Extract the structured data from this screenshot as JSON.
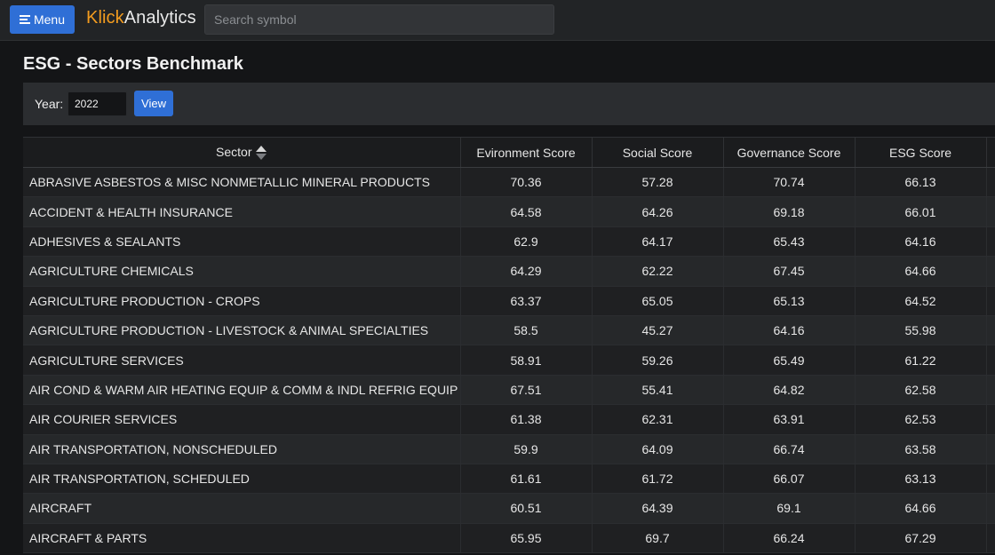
{
  "topbar": {
    "menu_label": "Menu",
    "brand_part1": "Klick",
    "brand_part2": "Analytics",
    "search_placeholder": "Search symbol"
  },
  "page": {
    "title": "ESG - Sectors Benchmark"
  },
  "filter": {
    "year_label": "Year:",
    "year_value": "2022",
    "view_label": "View"
  },
  "table": {
    "columns": [
      "Sector",
      "Evironment Score",
      "Social Score",
      "Governance Score",
      "ESG Score"
    ],
    "sort_column": "Sector",
    "sort_direction": "ascending",
    "rows": [
      [
        "ABRASIVE ASBESTOS & MISC NONMETALLIC MINERAL PRODUCTS",
        "70.36",
        "57.28",
        "70.74",
        "66.13"
      ],
      [
        "ACCIDENT & HEALTH INSURANCE",
        "64.58",
        "64.26",
        "69.18",
        "66.01"
      ],
      [
        "ADHESIVES & SEALANTS",
        "62.9",
        "64.17",
        "65.43",
        "64.16"
      ],
      [
        "AGRICULTURE CHEMICALS",
        "64.29",
        "62.22",
        "67.45",
        "64.66"
      ],
      [
        "AGRICULTURE PRODUCTION - CROPS",
        "63.37",
        "65.05",
        "65.13",
        "64.52"
      ],
      [
        "AGRICULTURE PRODUCTION - LIVESTOCK & ANIMAL SPECIALTIES",
        "58.5",
        "45.27",
        "64.16",
        "55.98"
      ],
      [
        "AGRICULTURE SERVICES",
        "58.91",
        "59.26",
        "65.49",
        "61.22"
      ],
      [
        "AIR COND & WARM AIR HEATING EQUIP & COMM & INDL REFRIG EQUIP",
        "67.51",
        "55.41",
        "64.82",
        "62.58"
      ],
      [
        "AIR COURIER SERVICES",
        "61.38",
        "62.31",
        "63.91",
        "62.53"
      ],
      [
        "AIR TRANSPORTATION, NONSCHEDULED",
        "59.9",
        "64.09",
        "66.74",
        "63.58"
      ],
      [
        "AIR TRANSPORTATION, SCHEDULED",
        "61.61",
        "61.72",
        "66.07",
        "63.13"
      ],
      [
        "AIRCRAFT",
        "60.51",
        "64.39",
        "69.1",
        "64.66"
      ],
      [
        "AIRCRAFT & PARTS",
        "65.95",
        "69.7",
        "66.24",
        "67.29"
      ]
    ]
  }
}
